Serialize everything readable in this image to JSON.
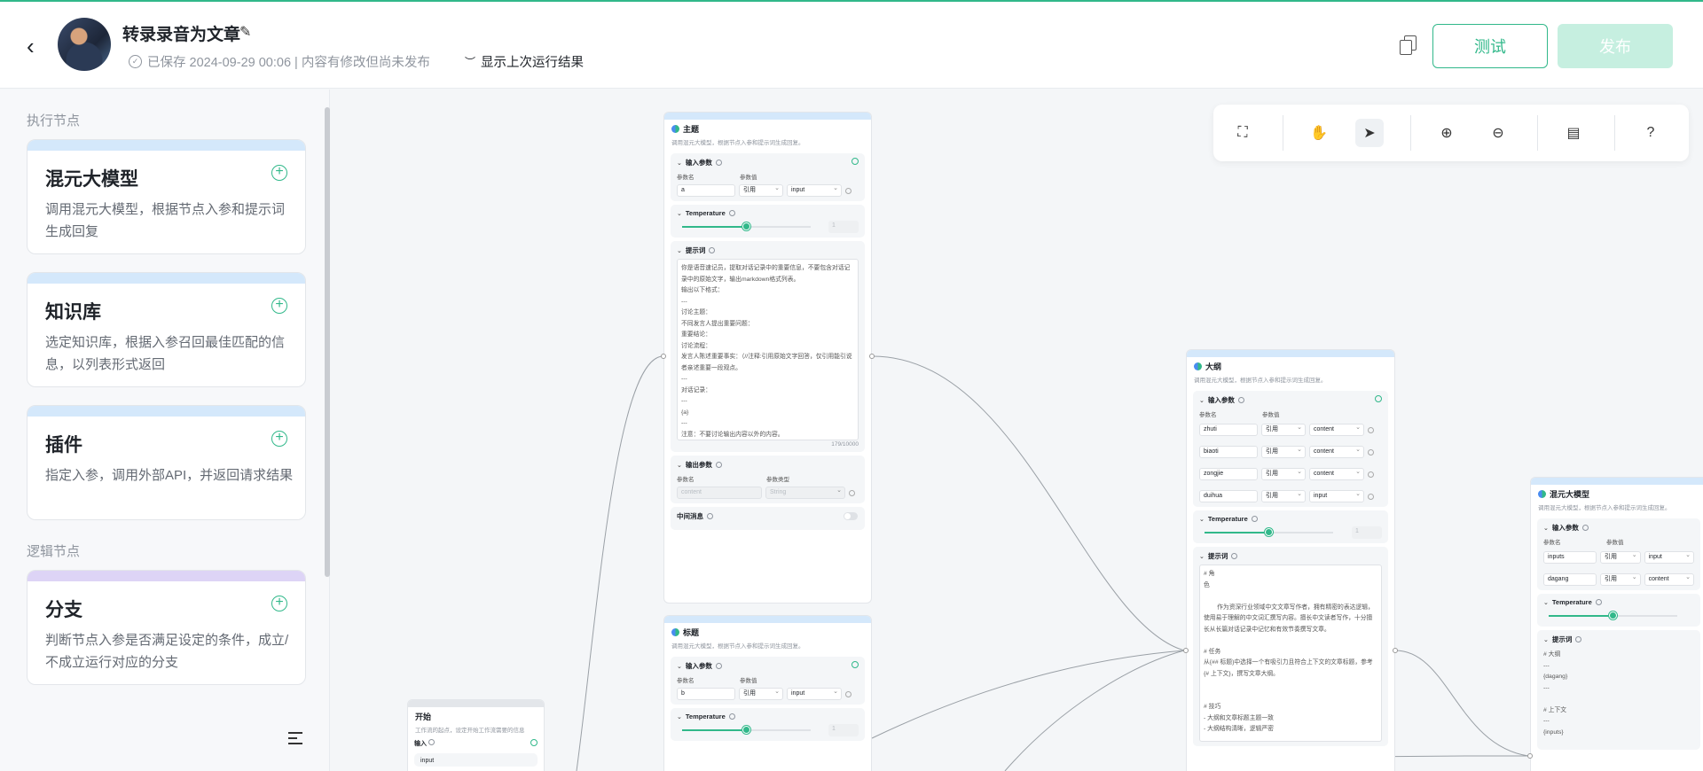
{
  "header": {
    "title": "转录录音为文章",
    "save_status": "已保存 2024-09-29 00:06 | 内容有修改但尚未发布",
    "show_last_run": "显示上次运行结果",
    "test_label": "测试",
    "publish_label": "发布",
    "accent": "#31b88a"
  },
  "sidebar": {
    "exec_section": "执行节点",
    "logic_section": "逻辑节点",
    "cards": [
      {
        "title": "混元大模型",
        "desc": "调用混元大模型，根据节点入参和提示词生成回复"
      },
      {
        "title": "知识库",
        "desc": "选定知识库，根据入参召回最佳匹配的信息，以列表形式返回"
      },
      {
        "title": "插件",
        "desc": "指定入参，调用外部API，并返回请求结果"
      },
      {
        "title": "分支",
        "desc": "判断节点入参是否满足设定的条件，成立/不成立运行对应的分支"
      }
    ]
  },
  "toolbar": {
    "icons": [
      "fullscreen-icon",
      "hand-icon",
      "pointer-icon",
      "zoom-in-icon",
      "zoom-out-icon",
      "layout-icon",
      "help-icon"
    ]
  },
  "nodes": {
    "common_desc": "调用混元大模型，根据节点入参和提示词生成回复。",
    "input_params": "输入参数",
    "output_params": "输出参数",
    "param_name": "参数名",
    "param_value": "参数值",
    "param_type": "参数类型",
    "ref": "引用",
    "temperature": "Temperature",
    "prompt": "提示词",
    "temp_value": "1",
    "intermediate": "中间消息",
    "zhuti": {
      "title": "主题",
      "param": "a",
      "source": "input",
      "prompt_text": "你是语音速记员，提取对话记录中的重要信息，不要包含对话记录中的原始文字，输出markdown格式列表。\n输出以下格式：\n---\n讨论主题：\n不同发言人提出重要问题：\n重要结论：\n讨论流程：\n发言人陈述重要事实：（//注释:引用原始文字回答，仅引用能引说者亲述重要一段观点。\n---\n对话记录：\n---\n{a}\n---\n注意：不要讨论输出内容以外的内容。",
      "counter": "179/10000",
      "out_name": "content",
      "out_type": "String"
    },
    "biaoti": {
      "title": "标题",
      "param": "b",
      "source": "input"
    },
    "start": {
      "title": "开始",
      "desc": "工作流的起点，设定开始工作流需要的信息",
      "input_label": "输入",
      "field": "input"
    },
    "dagang": {
      "title": "大纲",
      "params": [
        {
          "name": "zhuti",
          "source": "content"
        },
        {
          "name": "biaoti",
          "source": "content"
        },
        {
          "name": "zongjie",
          "source": "content"
        },
        {
          "name": "duihua",
          "source": "input"
        }
      ],
      "prompt_text": "# 角\n色\n\n        作为资深行业领域中文文章写作者，拥有精密的表达逻辑，使用易于理解的中文词汇撰写内容。擅长中文读者写作，十分擅长从长篇对话记录中记忆和有效节奏撰写文章。\n\n# 任务\n从{## 标题}中选择一个有吸引力且符合上下文的文章标题，参考{# 上下文}，撰写文章大纲。\n\n\n# 技巧\n- 大纲和文章标题主题一致\n- 大纲结构清晰，逻辑严密"
    },
    "hunyuan": {
      "title": "混元大模型",
      "params": [
        {
          "name": "inputs",
          "source": "input"
        },
        {
          "name": "dagang",
          "source": "content"
        }
      ],
      "prompt_text": "# 大纲\n---\n{dagang}\n---\n\n# 上下文\n---\n{inputs}"
    }
  }
}
